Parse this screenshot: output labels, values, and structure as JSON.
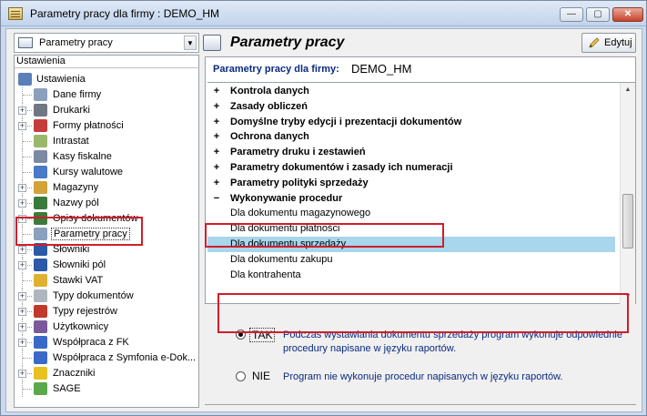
{
  "window": {
    "title": "Parametry pracy dla firmy : DEMO_HM",
    "minimize": "—",
    "maximize": "▢",
    "close": "✕"
  },
  "left": {
    "combo_value": "Parametry pracy",
    "panel_header": "Ustawienia",
    "tree": [
      {
        "label": "Ustawienia",
        "icon": "tools-icon",
        "expander": "",
        "root": true
      },
      {
        "label": "Dane firmy",
        "icon": "company-icon",
        "expander": ""
      },
      {
        "label": "Drukarki",
        "icon": "printer-icon",
        "expander": "+"
      },
      {
        "label": "Formy płatności",
        "icon": "payment-icon",
        "expander": "+"
      },
      {
        "label": "Intrastat",
        "icon": "intrastat-icon",
        "expander": ""
      },
      {
        "label": "Kasy fiskalne",
        "icon": "cash-register-icon",
        "expander": ""
      },
      {
        "label": "Kursy walutowe",
        "icon": "currency-chart-icon",
        "expander": ""
      },
      {
        "label": "Magazyny",
        "icon": "warehouse-icon",
        "expander": "+"
      },
      {
        "label": "Nazwy pól",
        "icon": "field-names-icon",
        "expander": "+"
      },
      {
        "label": "Opisy dokumentów",
        "icon": "doc-description-icon",
        "expander": "+"
      },
      {
        "label": "Parametry pracy",
        "icon": "work-params-icon",
        "expander": "",
        "selected": true
      },
      {
        "label": "Słowniki",
        "icon": "dictionary-icon",
        "expander": "+"
      },
      {
        "label": "Słowniki pól",
        "icon": "field-dictionary-icon",
        "expander": "+"
      },
      {
        "label": "Stawki VAT",
        "icon": "vat-icon",
        "expander": ""
      },
      {
        "label": "Typy dokumentów",
        "icon": "doc-types-icon",
        "expander": "+"
      },
      {
        "label": "Typy rejestrów",
        "icon": "register-types-icon",
        "expander": "+"
      },
      {
        "label": "Użytkownicy",
        "icon": "users-icon",
        "expander": "+"
      },
      {
        "label": "Współpraca z FK",
        "icon": "fk-sync-icon",
        "expander": "+"
      },
      {
        "label": "Współpraca z Symfonia e-Dok...",
        "icon": "edok-sync-icon",
        "expander": ""
      },
      {
        "label": "Znaczniki",
        "icon": "marker-icon",
        "expander": "+"
      },
      {
        "label": "SAGE",
        "icon": "sage-icon",
        "expander": ""
      }
    ]
  },
  "right": {
    "title": "Parametry pracy",
    "edit_label": "Edytuj",
    "firm_label": "Parametry pracy dla firmy:",
    "firm_name": "DEMO_HM",
    "items": [
      {
        "pm": "+",
        "label": "Kontrola danych",
        "bold": true
      },
      {
        "pm": "+",
        "label": "Zasady obliczeń",
        "bold": true
      },
      {
        "pm": "+",
        "label": "Domyślne tryby edycji i prezentacji dokumentów",
        "bold": true
      },
      {
        "pm": "+",
        "label": "Ochrona danych",
        "bold": true
      },
      {
        "pm": "+",
        "label": "Parametry druku i zestawień",
        "bold": true
      },
      {
        "pm": "+",
        "label": "Parametry dokumentów i zasady ich numeracji",
        "bold": true
      },
      {
        "pm": "+",
        "label": "Parametry polityki sprzedaży",
        "bold": true
      },
      {
        "pm": "−",
        "label": "Wykonywanie procedur",
        "bold": true
      },
      {
        "pm": "",
        "label": "Dla dokumentu magazynowego",
        "bold": false
      },
      {
        "pm": "",
        "label": "Dla dokumentu płatności",
        "bold": false
      },
      {
        "pm": "",
        "label": "Dla dokumentu sprzedaży",
        "bold": false,
        "selected": true
      },
      {
        "pm": "",
        "label": "Dla dokumentu zakupu",
        "bold": false
      },
      {
        "pm": "",
        "label": "Dla kontrahenta",
        "bold": false
      }
    ],
    "options": [
      {
        "key": "TAK",
        "checked": true,
        "desc": "Podczas wystawiania dokumentu sprzedaży program wykonuje odpowiednie procedury napisane w języku raportów."
      },
      {
        "key": "NIE",
        "checked": false,
        "desc": "Program nie wykonuje procedur napisanych w języku raportów."
      }
    ]
  },
  "colors": {
    "highlight_box": "#d11d2a",
    "selected_row": "#a8d6ec",
    "label_blue": "#0a2a80"
  }
}
